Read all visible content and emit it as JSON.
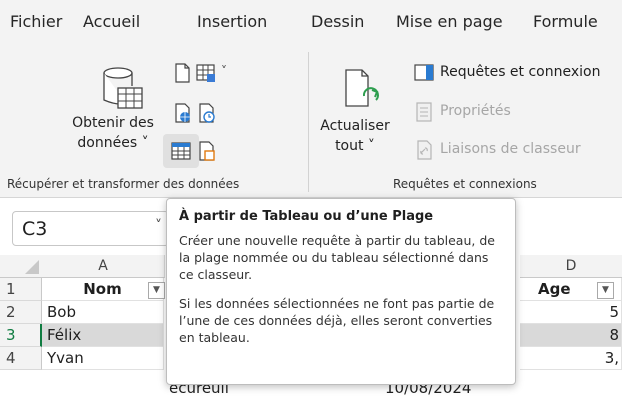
{
  "tabs": [
    "Fichier",
    "Accueil",
    "Insertion",
    "Dessin",
    "Mise en page",
    "Formule"
  ],
  "ribbon": {
    "get_data": {
      "label_line1": "Obtenir des",
      "label_line2": "données ˅"
    },
    "refresh": {
      "label_line1": "Actualiser",
      "label_line2": "tout ˅"
    },
    "queries_connections": "Requêtes et connexion",
    "properties": "Propriétés",
    "workbook_links": "Liaisons de classeur",
    "group_get_transform": "Récupérer et transformer des données",
    "group_queries": "Requêtes et connexions"
  },
  "formula_bar": {
    "name_box": "C3",
    "name_box_arrow": "˅"
  },
  "grid": {
    "columns": [
      "A",
      "D"
    ],
    "rows": [
      {
        "num": "1",
        "a": "Nom",
        "d": "Age"
      },
      {
        "num": "2",
        "a": "Bob",
        "d": "5"
      },
      {
        "num": "3",
        "a": "Félix",
        "d": "8"
      },
      {
        "num": "4",
        "a": "Yvan",
        "mid": "écureuil",
        "c": "10/08/2024",
        "d": "3,"
      }
    ]
  },
  "tooltip": {
    "title": "À partir de Tableau ou d’une Plage",
    "para1": "Créer une nouvelle requête à partir du tableau, de la plage nommée ou du tableau sélectionné dans ce classeur.",
    "para2": "Si les données sélectionnées ne font pas partie de l’une de ces données déjà, elles seront converties en tableau."
  },
  "colors": {
    "accent_green": "#107c41",
    "ribbon_bg": "#f3f3f3",
    "selected_row_shade": "#d9d9d9"
  }
}
